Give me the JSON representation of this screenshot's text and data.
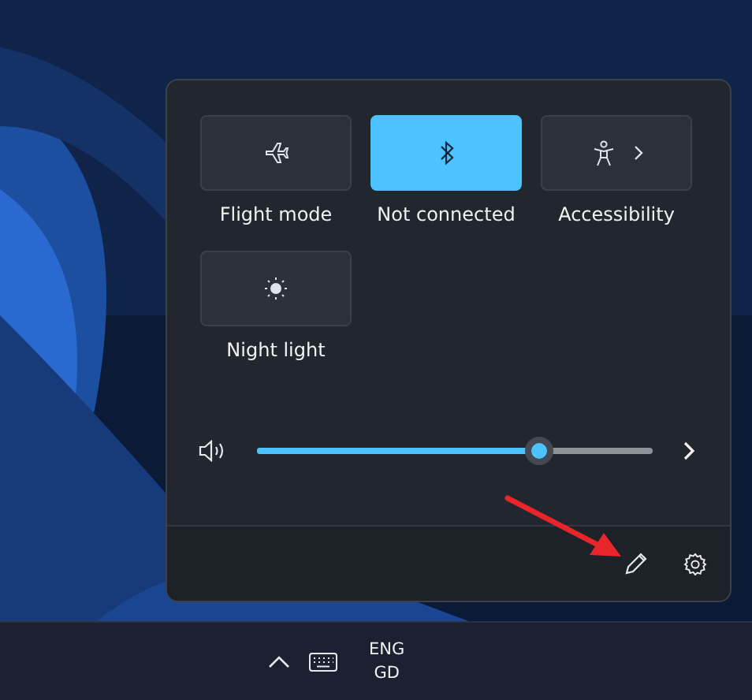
{
  "quick_settings": {
    "tiles": [
      {
        "kind": "airplane",
        "label": "Flight mode",
        "on": false,
        "expandable": false
      },
      {
        "kind": "bluetooth",
        "label": "Not connected",
        "on": true,
        "expandable": false
      },
      {
        "kind": "accessibility",
        "label": "Accessibility",
        "on": false,
        "expandable": true
      },
      {
        "kind": "night-light",
        "label": "Night light",
        "on": false,
        "expandable": false
      }
    ],
    "volume": {
      "level": 0.715
    }
  },
  "taskbar": {
    "language": "ENG",
    "layout": "GD"
  }
}
